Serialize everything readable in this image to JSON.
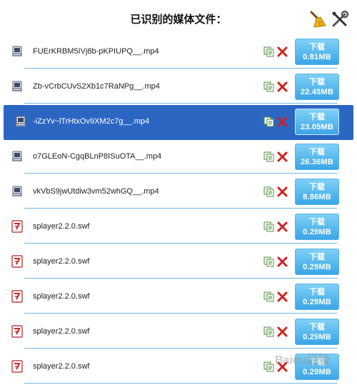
{
  "header": {
    "title": "已识别的媒体文件：",
    "broom_icon": "broom-icon",
    "tools_icon": "tools-icon"
  },
  "files": [
    {
      "name": "FUErKRBM5IVj8b-pKPIUPQ__.mp4",
      "type": "video",
      "download_label": "下载",
      "size": "0.81MB",
      "selected": false
    },
    {
      "name": "Zb-vCrbCUvS2Xb1c7RaNPg__.mp4",
      "type": "video",
      "download_label": "下载",
      "size": "22.45MB",
      "selected": false
    },
    {
      "name": "-iZzYv~lTrHtxOv9XM2c7g__.mp4",
      "type": "video",
      "download_label": "下载",
      "size": "23.05MB",
      "selected": true
    },
    {
      "name": "o7GLEoN-CgqBLnP8ISuOTA__.mp4",
      "type": "video",
      "download_label": "下载",
      "size": "26.36MB",
      "selected": false
    },
    {
      "name": "vkVbS9jwUtdiw3vm52whGQ__.mp4",
      "type": "video",
      "download_label": "下载",
      "size": "8.86MB",
      "selected": false
    },
    {
      "name": "splayer2.2.0.swf",
      "type": "flash",
      "download_label": "下载",
      "size": "0.29MB",
      "selected": false
    },
    {
      "name": "splayer2.2.0.swf",
      "type": "flash",
      "download_label": "下载",
      "size": "0.29MB",
      "selected": false
    },
    {
      "name": "splayer2.2.0.swf",
      "type": "flash",
      "download_label": "下载",
      "size": "0.29MB",
      "selected": false
    },
    {
      "name": "splayer2.2.0.swf",
      "type": "flash",
      "download_label": "下载",
      "size": "0.29MB",
      "selected": false
    },
    {
      "name": "splayer2.2.0.swf",
      "type": "flash",
      "download_label": "下载",
      "size": "0.29MB",
      "selected": false
    }
  ],
  "colors": {
    "accent": "#2c66c3",
    "download_button": "#3aa6e6",
    "separator": "#6fb7df",
    "delete": "#d21f1f"
  },
  "watermark": "Baidu经验"
}
